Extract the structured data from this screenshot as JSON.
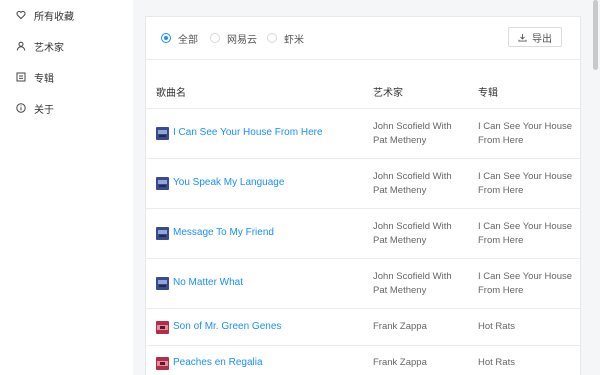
{
  "sidebar": {
    "items": [
      {
        "label": "所有收藏",
        "icon": "heart-icon"
      },
      {
        "label": "艺术家",
        "icon": "user-icon"
      },
      {
        "label": "专辑",
        "icon": "album-icon"
      },
      {
        "label": "关于",
        "icon": "info-icon"
      }
    ]
  },
  "filters": {
    "options": [
      {
        "label": "全部",
        "selected": true
      },
      {
        "label": "网易云",
        "selected": false
      },
      {
        "label": "虾米",
        "selected": false
      }
    ],
    "export_label": "导出"
  },
  "table": {
    "headers": {
      "song": "歌曲名",
      "artist": "艺术家",
      "album": "专辑"
    },
    "rows": [
      {
        "song": "I Can See Your House From Here",
        "artist": "John Scofield With Pat Metheny",
        "album": "I Can See Your House From Here",
        "cover": "blue"
      },
      {
        "song": "You Speak My Language",
        "artist": "John Scofield With Pat Metheny",
        "album": "I Can See Your House From Here",
        "cover": "blue"
      },
      {
        "song": "Message To My Friend",
        "artist": "John Scofield With Pat Metheny",
        "album": "I Can See Your House From Here",
        "cover": "blue"
      },
      {
        "song": "No Matter What",
        "artist": "John Scofield With Pat Metheny",
        "album": "I Can See Your House From Here",
        "cover": "blue"
      },
      {
        "song": "Son of Mr. Green Genes",
        "artist": "Frank Zappa",
        "album": "Hot Rats",
        "cover": "red"
      },
      {
        "song": "Peaches en Regalia",
        "artist": "Frank Zappa",
        "album": "Hot Rats",
        "cover": "red"
      }
    ]
  },
  "colors": {
    "accent": "#1890ff",
    "cover_blue": "#3a4a8c",
    "cover_red": "#b0304a"
  }
}
